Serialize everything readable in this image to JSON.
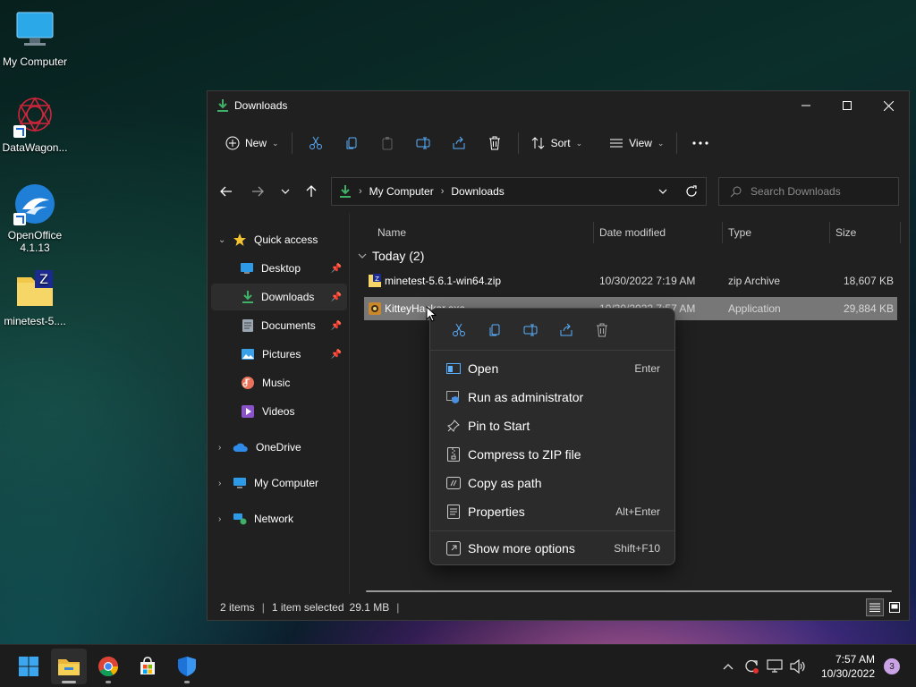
{
  "desktop": {
    "icons": [
      {
        "label": "My Computer"
      },
      {
        "label": "DataWagon..."
      },
      {
        "label": "OpenOffice 4.1.13"
      },
      {
        "label": "minetest-5...."
      }
    ]
  },
  "window": {
    "title": "Downloads",
    "toolbar": {
      "new_label": "New",
      "sort_label": "Sort",
      "view_label": "View"
    },
    "address": {
      "crumbs": [
        "My Computer",
        "Downloads"
      ]
    },
    "search": {
      "placeholder": "Search Downloads"
    },
    "sidebar": {
      "quick_access": "Quick access",
      "items": [
        {
          "label": "Desktop",
          "pinned": true
        },
        {
          "label": "Downloads",
          "pinned": true
        },
        {
          "label": "Documents",
          "pinned": true
        },
        {
          "label": "Pictures",
          "pinned": true
        },
        {
          "label": "Music",
          "pinned": false
        },
        {
          "label": "Videos",
          "pinned": false
        }
      ],
      "roots": [
        {
          "label": "OneDrive"
        },
        {
          "label": "My Computer"
        },
        {
          "label": "Network"
        }
      ]
    },
    "columns": {
      "name": "Name",
      "date": "Date modified",
      "type": "Type",
      "size": "Size"
    },
    "group": "Today (2)",
    "files": [
      {
        "name": "minetest-5.6.1-win64.zip",
        "date": "10/30/2022 7:19 AM",
        "type": "zip Archive",
        "size": "18,607 KB"
      },
      {
        "name": "KitteyHacker.exe",
        "date": "10/30/2022 7:57 AM",
        "type": "Application",
        "size": "29,884 KB"
      }
    ],
    "status": {
      "count": "2 items",
      "selection": "1 item selected",
      "size": "29.1 MB"
    }
  },
  "context_menu": {
    "items": [
      {
        "label": "Open",
        "shortcut": "Enter"
      },
      {
        "label": "Run as administrator",
        "shortcut": ""
      },
      {
        "label": "Pin to Start",
        "shortcut": ""
      },
      {
        "label": "Compress to ZIP file",
        "shortcut": ""
      },
      {
        "label": "Copy as path",
        "shortcut": ""
      },
      {
        "label": "Properties",
        "shortcut": "Alt+Enter"
      },
      {
        "label": "Show more options",
        "shortcut": "Shift+F10"
      }
    ]
  },
  "taskbar": {
    "time": "7:57 AM",
    "date": "10/30/2022",
    "notification_count": "3"
  },
  "colors": {
    "accent": "#0a84ff",
    "folder_download": "#3fb068",
    "window_bg": "#202020",
    "menu_bg": "#2b2b2b",
    "selected_row": "#777777"
  }
}
